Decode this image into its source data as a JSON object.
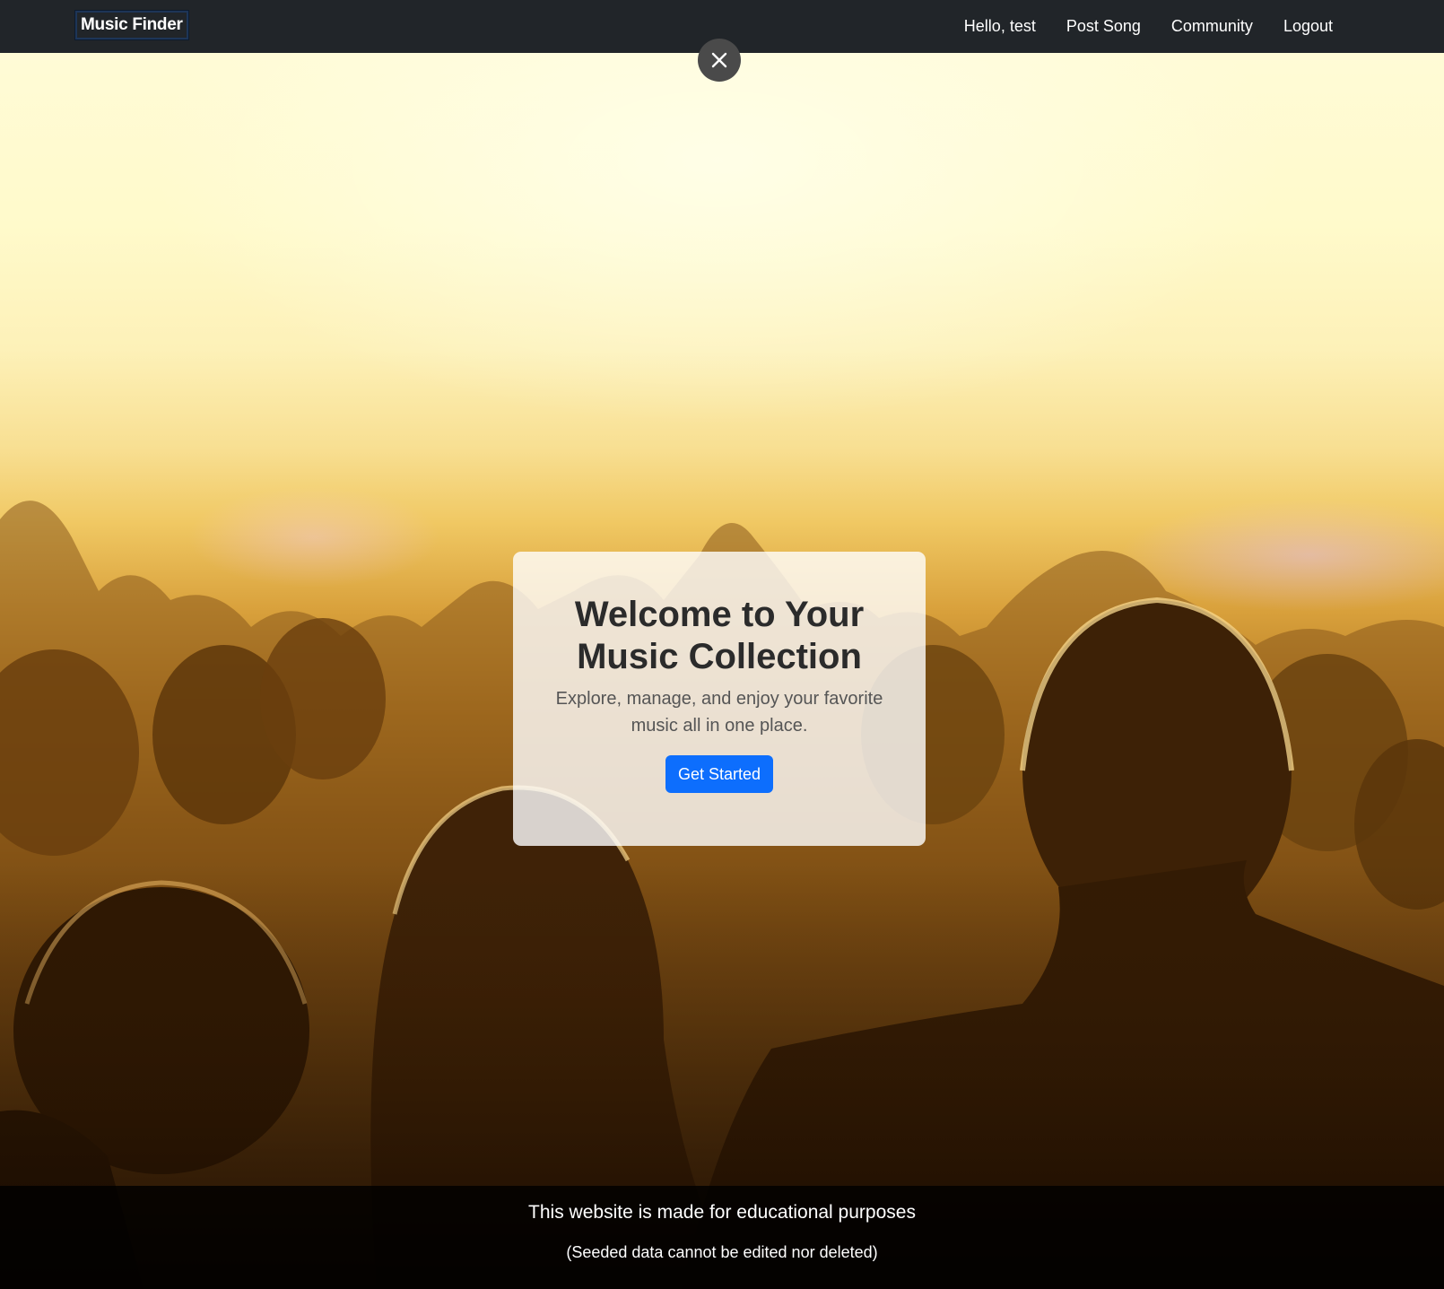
{
  "navbar": {
    "brand": "Music Finder",
    "links": [
      {
        "label": "Hello, test"
      },
      {
        "label": "Post Song"
      },
      {
        "label": "Community"
      },
      {
        "label": "Logout"
      }
    ],
    "background_color": "#212529"
  },
  "close_button": {
    "icon": "close-icon"
  },
  "hero": {
    "title": "Welcome to Your Music Collection",
    "subtitle": "Explore, manage, and enjoy your favorite music all in one place.",
    "cta_label": "Get Started",
    "cta_color": "#0d6efd"
  },
  "footer": {
    "main_text": "This website is made for educational purposes",
    "note": "(Seeded data cannot be edited nor deleted)"
  }
}
